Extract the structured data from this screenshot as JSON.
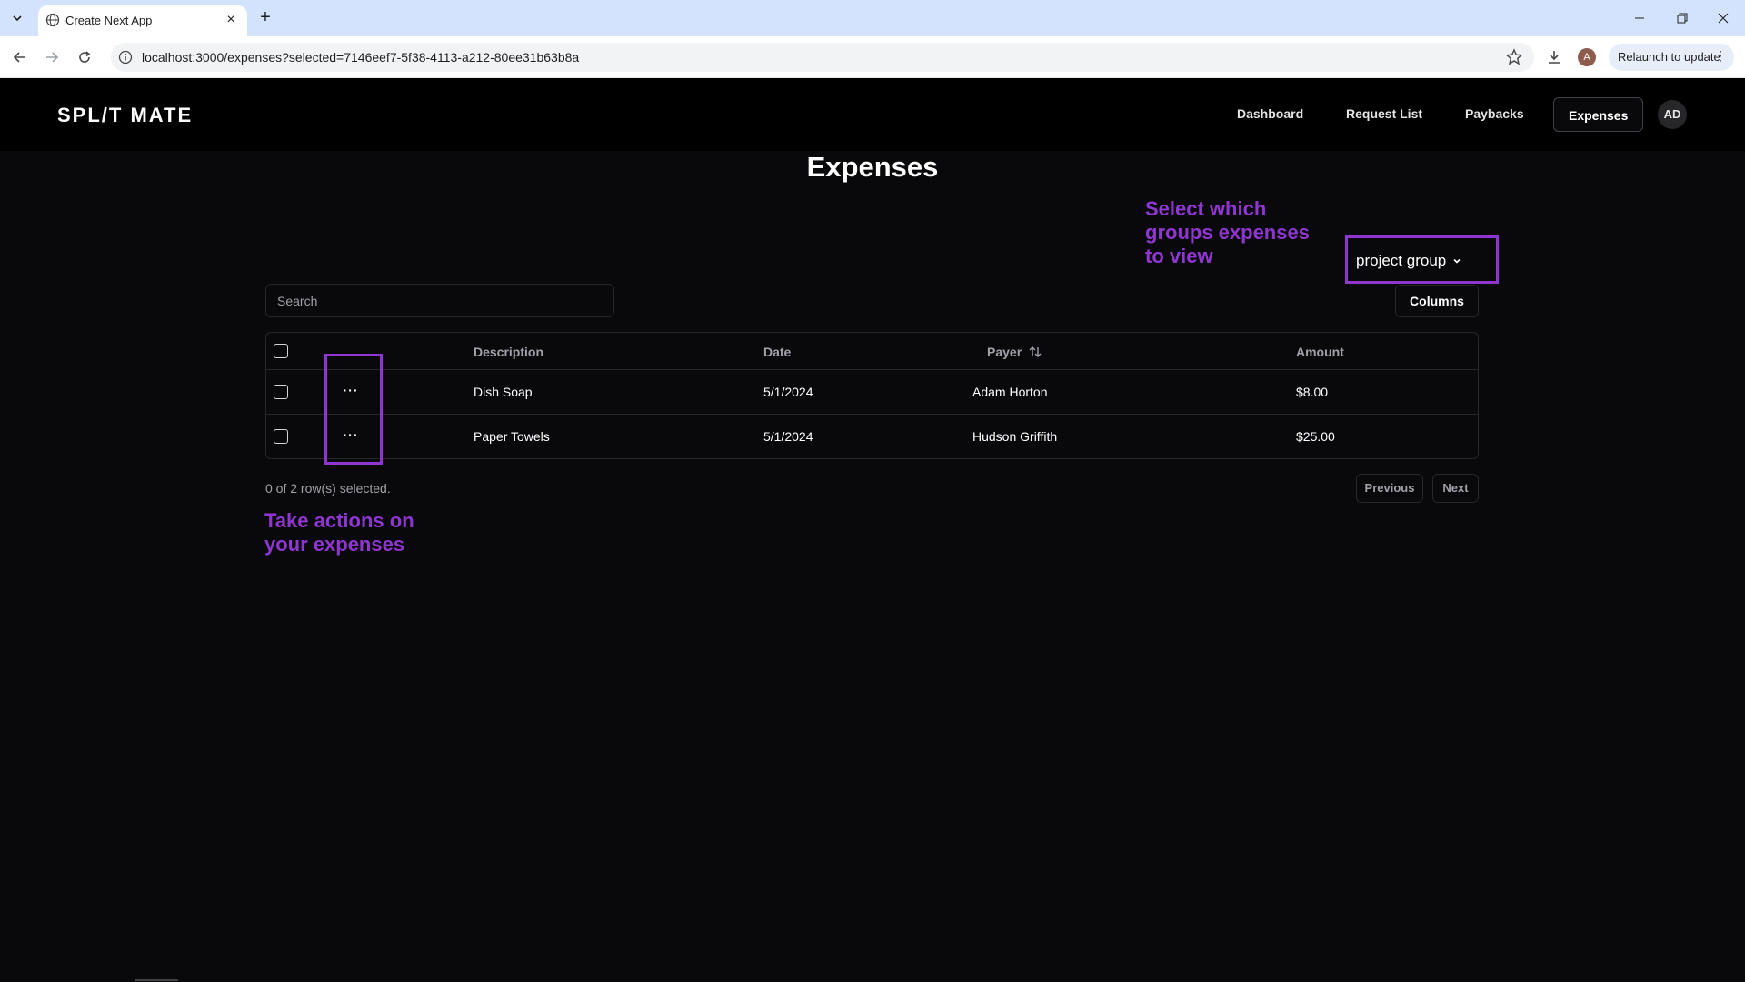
{
  "browser": {
    "tab_title": "Create Next App",
    "url": "localhost:3000/expenses?selected=7146eef7-5f38-4113-a212-80ee31b63b8a",
    "profile_initial": "A",
    "relaunch_label": "Relaunch to update"
  },
  "header": {
    "logo": "SPL/T MATE",
    "nav": [
      "Dashboard",
      "Request List",
      "Paybacks",
      "Expenses"
    ],
    "active_nav": "Expenses",
    "avatar_initials": "AD"
  },
  "page": {
    "title": "Expenses",
    "group_select_value": "project group",
    "search_placeholder": "Search",
    "columns_label": "Columns"
  },
  "annotations": {
    "groups": [
      "Select which",
      "groups expenses",
      "to view"
    ],
    "actions": [
      "Take actions on",
      "your expenses"
    ],
    "color": "#8e36cf"
  },
  "table": {
    "headers": {
      "description": "Description",
      "date": "Date",
      "payer": "Payer",
      "amount": "Amount"
    },
    "rows": [
      {
        "description": "Dish Soap",
        "date": "5/1/2024",
        "payer": "Adam Horton",
        "amount": "$8.00"
      },
      {
        "description": "Paper Towels",
        "date": "5/1/2024",
        "payer": "Hudson Griffith",
        "amount": "$25.00"
      }
    ]
  },
  "footer": {
    "selection_text": "0 of 2 row(s) selected.",
    "previous_label": "Previous",
    "next_label": "Next"
  }
}
